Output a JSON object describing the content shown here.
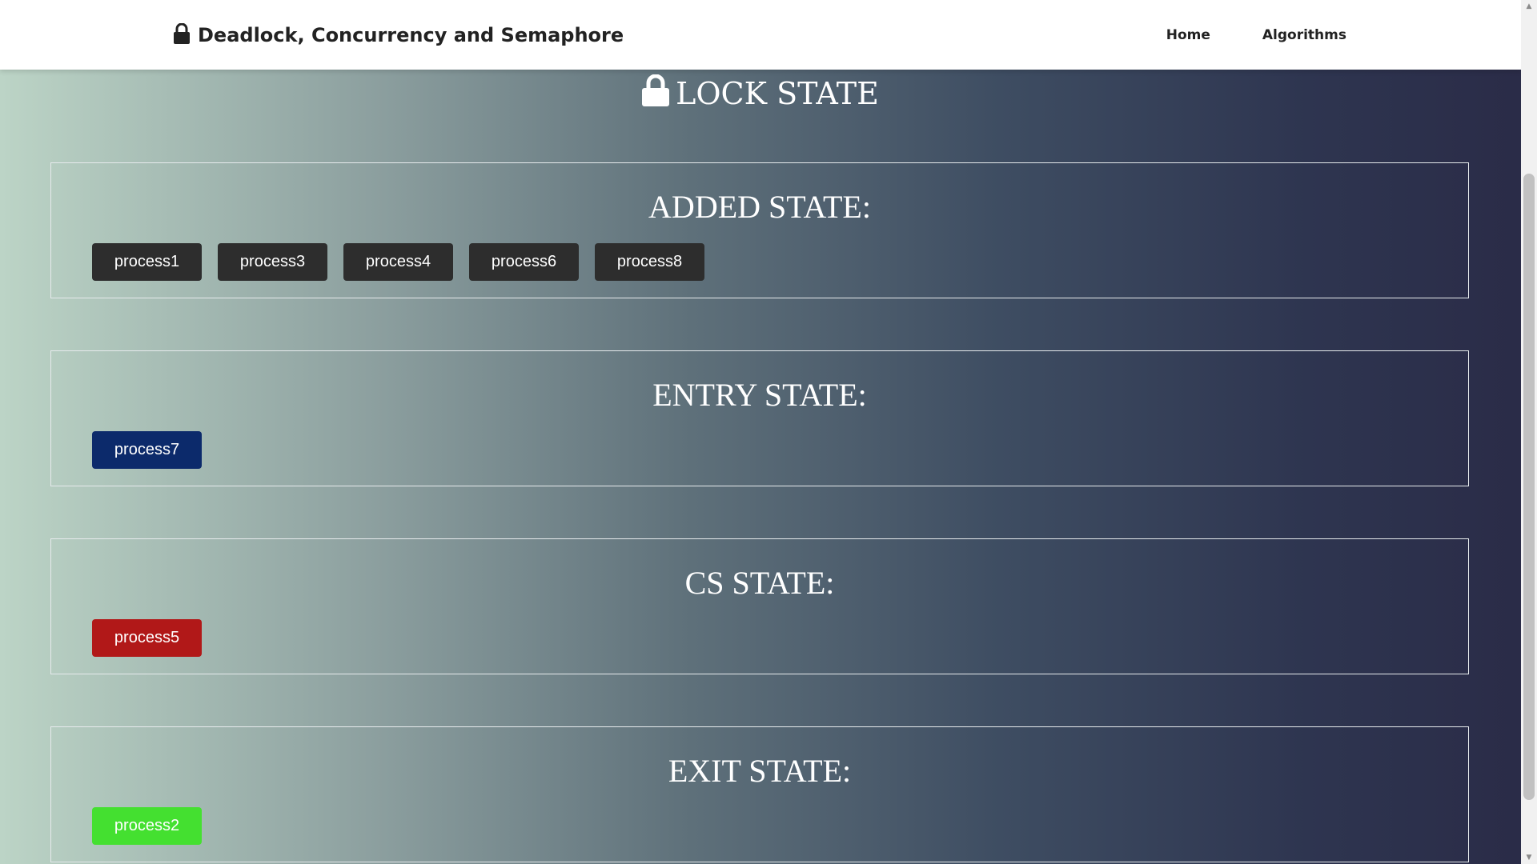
{
  "navbar": {
    "brand_title": "Deadlock, Concurrency and Semaphore",
    "links": [
      {
        "label": "Home"
      },
      {
        "label": "Algorithms"
      }
    ]
  },
  "page": {
    "title": "LOCK STATE"
  },
  "states": {
    "added": {
      "title": "ADDED STATE:",
      "color": "#2d2d2d",
      "processes": [
        "process1",
        "process3",
        "process4",
        "process6",
        "process8"
      ]
    },
    "entry": {
      "title": "ENTRY STATE:",
      "color": "#0c2a6b",
      "processes": [
        "process7"
      ]
    },
    "cs": {
      "title": "CS STATE:",
      "color": "#b11818",
      "processes": [
        "process5"
      ]
    },
    "exit": {
      "title": "EXIT STATE:",
      "color": "#44e030",
      "processes": [
        "process2"
      ]
    }
  },
  "icons": {
    "brand": "lock-icon",
    "title": "lock-icon"
  }
}
